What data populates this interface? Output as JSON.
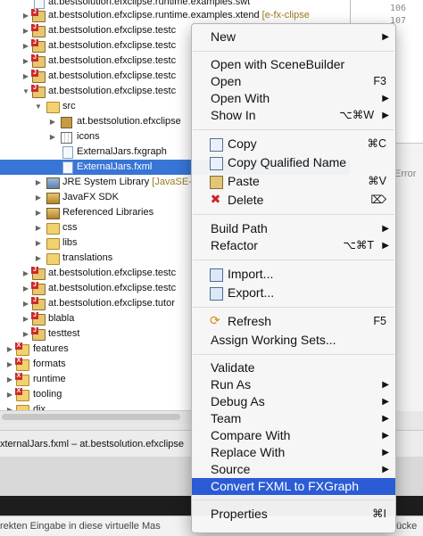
{
  "tree": {
    "rows": [
      {
        "label": "at.bestsolution.efxclipse.runtime.examples.swt",
        "sub": ""
      },
      {
        "label": "at.bestsolution.efxclipse.runtime.examples.xtend",
        "sub": " [e-fx-clipse"
      },
      {
        "label": "at.bestsolution.efxclipse.testc",
        "sub": ""
      },
      {
        "label": "at.bestsolution.efxclipse.testc",
        "sub": ""
      },
      {
        "label": "at.bestsolution.efxclipse.testc",
        "sub": ""
      },
      {
        "label": "at.bestsolution.efxclipse.testc",
        "sub": ""
      },
      {
        "label": "src",
        "sub": ""
      },
      {
        "label": "at.bestsolution.efxclipse",
        "sub": ""
      },
      {
        "label": "icons",
        "sub": ""
      },
      {
        "label": "ExternalJars.fxgraph",
        "sub": ""
      },
      {
        "label": "ExternalJars.fxml",
        "sub": ""
      },
      {
        "label": "JRE System Library",
        "sub": " [JavaSE-"
      },
      {
        "label": "JavaFX SDK",
        "sub": ""
      },
      {
        "label": "Referenced Libraries",
        "sub": ""
      },
      {
        "label": "css",
        "sub": ""
      },
      {
        "label": "libs",
        "sub": ""
      },
      {
        "label": "translations",
        "sub": ""
      },
      {
        "label": "at.bestsolution.efxclipse.testc",
        "sub": ""
      },
      {
        "label": "at.bestsolution.efxclipse.testc",
        "sub": ""
      },
      {
        "label": "at.bestsolution.efxclipse.tutor",
        "sub": ""
      },
      {
        "label": "blabla",
        "sub": ""
      },
      {
        "label": "testtest",
        "sub": ""
      },
      {
        "label": "features",
        "sub": ""
      },
      {
        "label": "formats",
        "sub": ""
      },
      {
        "label": "runtime",
        "sub": ""
      },
      {
        "label": "tooling",
        "sub": ""
      },
      {
        "label": "dix",
        "sub": ""
      }
    ]
  },
  "editor": {
    "line_numbers": [
      "106",
      "107"
    ]
  },
  "lower_panel": {
    "label": "Error"
  },
  "path_bar": {
    "text": "xternalJars.fxml – at.bestsolution.efxclipse"
  },
  "status_bar": {
    "left": "rekten Eingabe in diese virtuelle Mas",
    "right": "ücke"
  },
  "menu": {
    "new": "New",
    "open_scenebuilder": "Open with SceneBuilder",
    "open": "Open",
    "open_key": "F3",
    "open_with": "Open With",
    "show_in": "Show In",
    "show_in_key": "⌥⌘W",
    "copy": "Copy",
    "copy_key": "⌘C",
    "copy_qualified": "Copy Qualified Name",
    "paste": "Paste",
    "paste_key": "⌘V",
    "delete": "Delete",
    "delete_key": "⌦",
    "build_path": "Build Path",
    "refactor": "Refactor",
    "refactor_key": "⌥⌘T",
    "import": "Import...",
    "export": "Export...",
    "refresh": "Refresh",
    "refresh_key": "F5",
    "assign_sets": "Assign Working Sets...",
    "validate": "Validate",
    "run_as": "Run As",
    "debug_as": "Debug As",
    "team": "Team",
    "compare_with": "Compare With",
    "replace_with": "Replace With",
    "source": "Source",
    "convert": "Convert FXML to FXGraph",
    "properties": "Properties",
    "properties_key": "⌘I",
    "submenu_arrow": "▶",
    "highlight_color": "#2b5cd6"
  },
  "colors": {
    "selection": "#3875d7"
  }
}
